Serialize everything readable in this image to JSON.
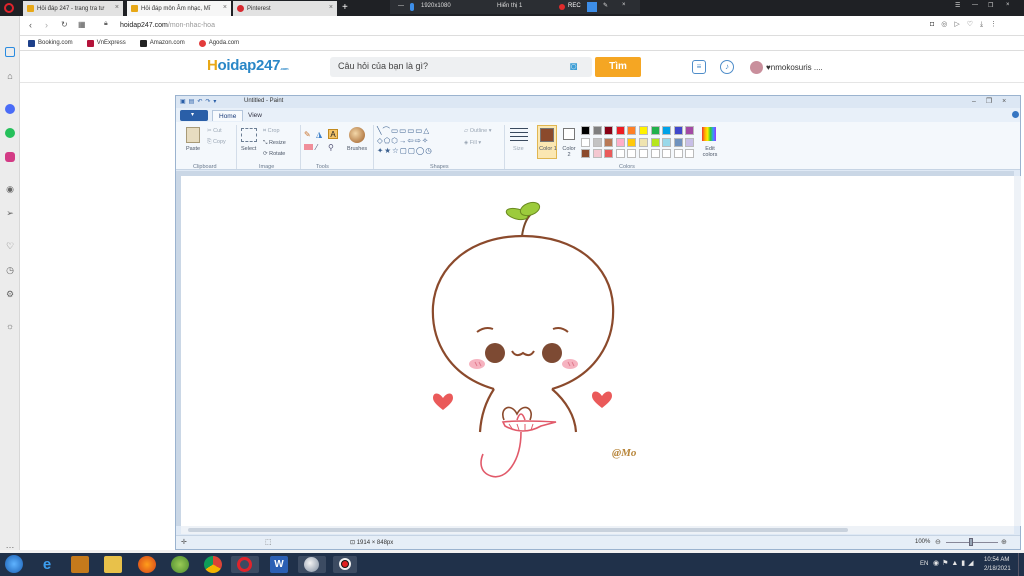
{
  "browser": {
    "tabs": [
      {
        "label": "Hỏi đáp 247 - trang tra tư",
        "active": false
      },
      {
        "label": "Hỏi đáp môn Âm nhạc, Mĩ",
        "active": true
      },
      {
        "label": "Pinterest",
        "active": false
      }
    ],
    "new_tab": "+",
    "recorder": {
      "resolution": "1920x1080",
      "display": "Hiển thị 1",
      "rec": "REC"
    },
    "url": {
      "host": "hoidap247.com",
      "path": "/mon-nhac-hoa"
    },
    "bookmarks": [
      "Booking.com",
      "VnExpress",
      "Amazon.com",
      "Agoda.com"
    ]
  },
  "site": {
    "logo_h": "H",
    "logo_rest": "oidap247",
    "logo_sub": ".com",
    "search_placeholder": "Câu hỏi của bạn là gì?",
    "search_button": "Tìm",
    "username": "♥nmokosuris ...."
  },
  "paint": {
    "title": "Untitled - Paint",
    "file_menu": "▾",
    "tabs": [
      "Home",
      "View"
    ],
    "clipboard": {
      "paste": "Paste",
      "cut": "Cut",
      "copy": "Copy",
      "group": "Clipboard"
    },
    "image": {
      "select": "Select",
      "crop": "Crop",
      "resize": "Resize",
      "rotate": "Rotate",
      "group": "Image"
    },
    "tools_group": "Tools",
    "brushes": "Brushes",
    "shapes": {
      "outline": "Outline",
      "fill": "Fill",
      "group": "Shapes"
    },
    "size": "Size",
    "color1": "Color 1",
    "color2": "Color 2",
    "edit_colors": "Edit colors",
    "colors_group": "Colors",
    "palette_row1": [
      "#000000",
      "#7f7f7f",
      "#880015",
      "#ed1c24",
      "#ff7f27",
      "#fff200",
      "#22b14c",
      "#00a2e8",
      "#3f48cc",
      "#a349a4"
    ],
    "palette_row2": [
      "#ffffff",
      "#c3c3c3",
      "#b97a57",
      "#ffaec9",
      "#ffc90e",
      "#efe4b0",
      "#b5e61d",
      "#99d9ea",
      "#7092be",
      "#c8bfe7"
    ],
    "palette_row3": [
      "#8b4a2c",
      "#f4c7d0",
      "#ea5a5a",
      "#ffffff",
      "#ffffff",
      "#ffffff",
      "#ffffff",
      "#ffffff",
      "#ffffff",
      "#ffffff"
    ],
    "color1_value": "#8b4a2c",
    "canvas_size": "1914 × 848px",
    "zoom": "100%",
    "signature": "@Mo"
  },
  "taskbar": {
    "lang": "EN",
    "time": "10:54 AM",
    "date": "2/18/2021"
  }
}
